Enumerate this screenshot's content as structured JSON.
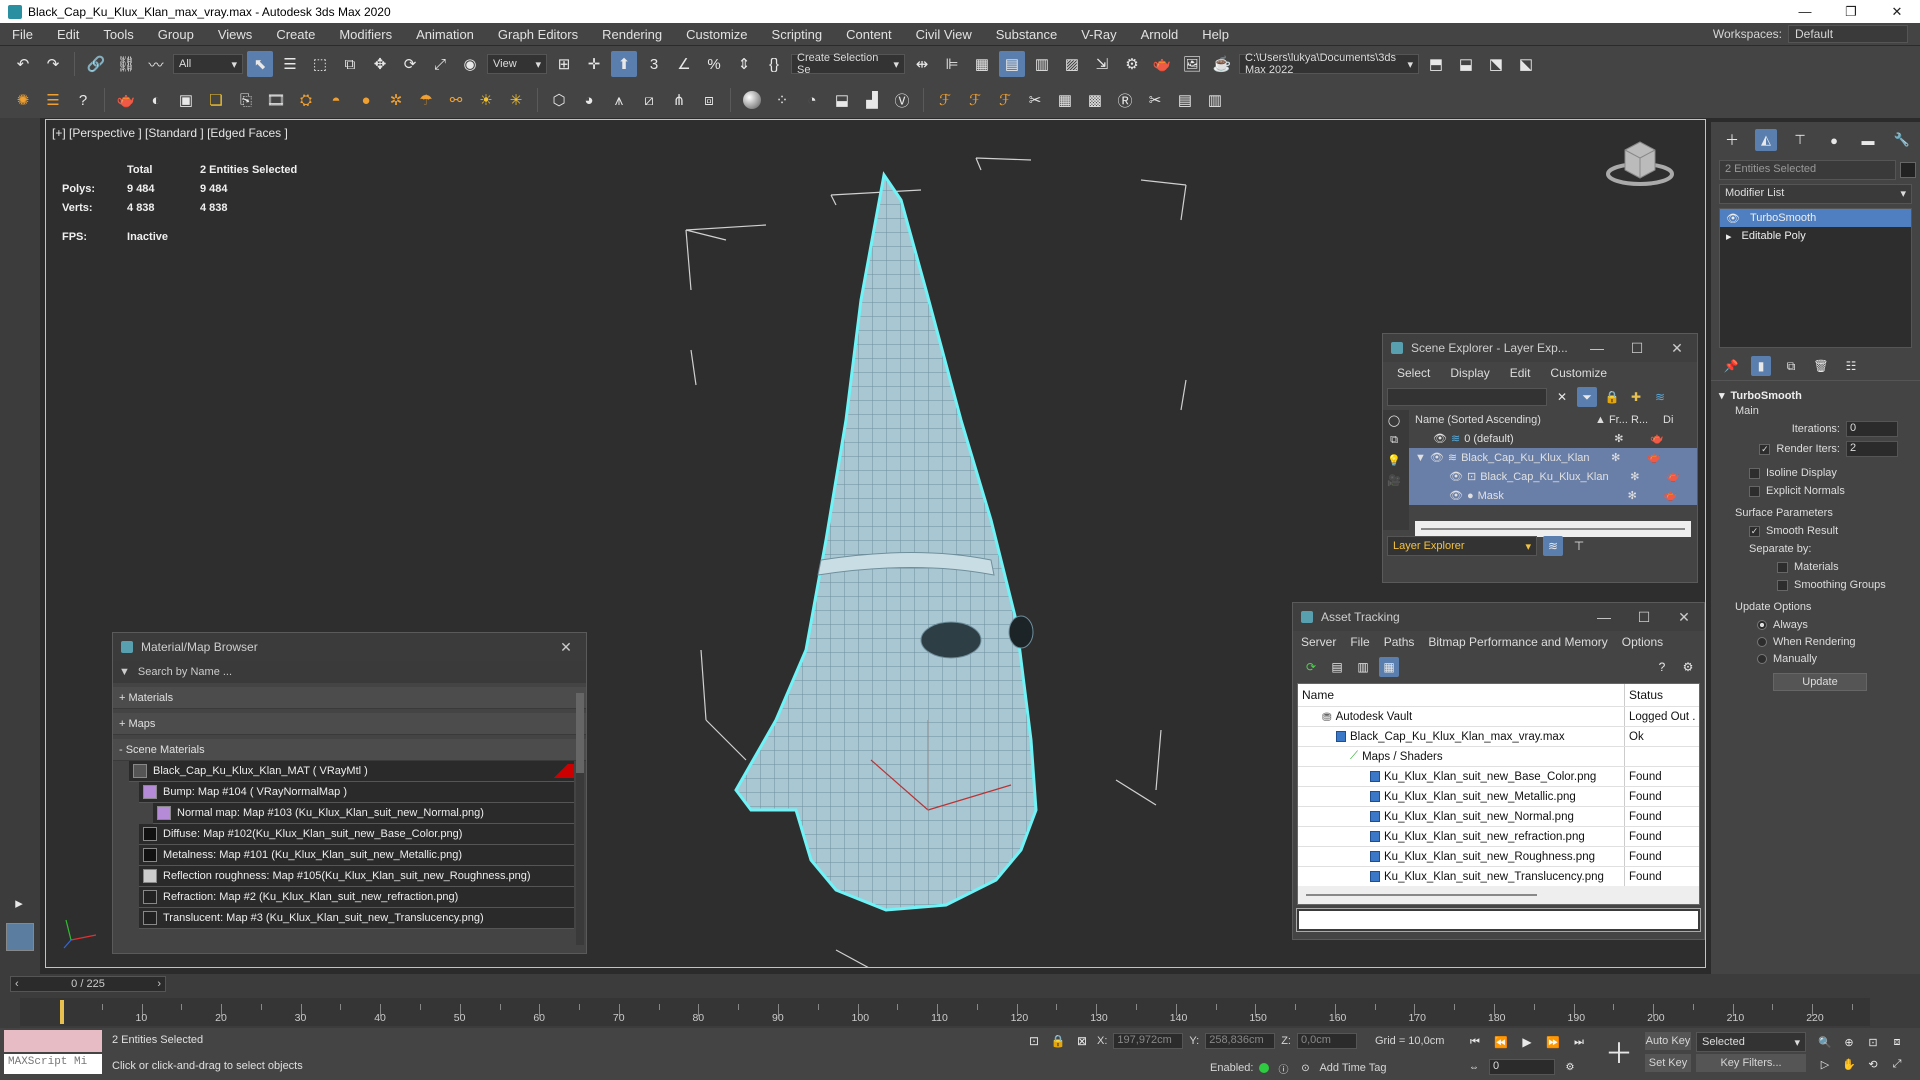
{
  "window": {
    "title": "Black_Cap_Ku_Klux_Klan_max_vray.max - Autodesk 3ds Max 2020"
  },
  "menu": [
    "File",
    "Edit",
    "Tools",
    "Group",
    "Views",
    "Create",
    "Modifiers",
    "Animation",
    "Graph Editors",
    "Rendering",
    "Customize",
    "Scripting",
    "Content",
    "Civil View",
    "Substance",
    "V-Ray",
    "Arnold",
    "Help"
  ],
  "workspace": {
    "label": "Workspaces:",
    "value": "Default"
  },
  "toolbar": {
    "filter": "All",
    "view": "View",
    "selection_set": "Create Selection Se",
    "path": "C:\\Users\\lukya\\Documents\\3ds Max 2022"
  },
  "viewport": {
    "label": "[+] [Perspective ] [Standard ] [Edged Faces ]",
    "stats": {
      "total_label": "Total",
      "selected_label": "2 Entities Selected",
      "polys_label": "Polys:",
      "polys_total": "9 484",
      "polys_sel": "9 484",
      "verts_label": "Verts:",
      "verts_total": "4 838",
      "verts_sel": "4 838",
      "fps_label": "FPS:",
      "fps_value": "Inactive"
    }
  },
  "material_browser": {
    "title": "Material/Map Browser",
    "search_placeholder": "Search by Name ...",
    "sections": [
      "+ Materials",
      "+ Maps",
      "- Scene Materials"
    ],
    "items": [
      {
        "label": "Black_Cap_Ku_Klux_Klan_MAT  ( VRayMtl )",
        "swatch": "#555555"
      },
      {
        "label": "Bump: Map #104  ( VRayNormalMap )",
        "swatch": "#b58bd8"
      },
      {
        "label": "Normal map: Map #103 (Ku_Klux_Klan_suit_new_Normal.png)",
        "swatch": "#b58bd8"
      },
      {
        "label": "Diffuse: Map #102(Ku_Klux_Klan_suit_new_Base_Color.png)",
        "swatch": "#111111"
      },
      {
        "label": "Metalness: Map #101 (Ku_Klux_Klan_suit_new_Metallic.png)",
        "swatch": "#111111"
      },
      {
        "label": "Reflection roughness: Map #105(Ku_Klux_Klan_suit_new_Roughness.png)",
        "swatch": "#cccccc"
      },
      {
        "label": "Refraction: Map #2 (Ku_Klux_Klan_suit_new_refraction.png)",
        "swatch": "#222222"
      },
      {
        "label": "Translucent: Map #3 (Ku_Klux_Klan_suit_new_Translucency.png)",
        "swatch": "#222222"
      }
    ]
  },
  "scene_explorer": {
    "title": "Scene Explorer - Layer Exp...",
    "menu": [
      "Select",
      "Display",
      "Edit",
      "Customize"
    ],
    "col_name": "Name (Sorted Ascending)",
    "col_fr": "▲ Fr...",
    "col_r": "R...",
    "col_di": "Di",
    "rows": [
      {
        "label": "0 (default)",
        "selected": false,
        "indent": 0
      },
      {
        "label": "Black_Cap_Ku_Klux_Klan",
        "selected": true,
        "indent": 0
      },
      {
        "label": "Black_Cap_Ku_Klux_Klan",
        "selected": true,
        "indent": 1
      },
      {
        "label": "Mask",
        "selected": true,
        "indent": 1
      }
    ],
    "footer": "Layer Explorer"
  },
  "asset_tracking": {
    "title": "Asset Tracking",
    "menu": [
      "Server",
      "File",
      "Paths",
      "Bitmap Performance and Memory",
      "Options"
    ],
    "col_name": "Name",
    "col_status": "Status",
    "rows": [
      {
        "name": "Autodesk Vault",
        "status": "Logged Out .",
        "indent": 1
      },
      {
        "name": "Black_Cap_Ku_Klux_Klan_max_vray.max",
        "status": "Ok",
        "indent": 2
      },
      {
        "name": "Maps / Shaders",
        "status": "",
        "indent": 3
      },
      {
        "name": "Ku_Klux_Klan_suit_new_Base_Color.png",
        "status": "Found",
        "indent": 4
      },
      {
        "name": "Ku_Klux_Klan_suit_new_Metallic.png",
        "status": "Found",
        "indent": 4
      },
      {
        "name": "Ku_Klux_Klan_suit_new_Normal.png",
        "status": "Found",
        "indent": 4
      },
      {
        "name": "Ku_Klux_Klan_suit_new_refraction.png",
        "status": "Found",
        "indent": 4
      },
      {
        "name": "Ku_Klux_Klan_suit_new_Roughness.png",
        "status": "Found",
        "indent": 4
      },
      {
        "name": "Ku_Klux_Klan_suit_new_Translucency.png",
        "status": "Found",
        "indent": 4
      }
    ]
  },
  "command_panel": {
    "selection": "2 Entities Selected",
    "modifier_list": "Modifier List",
    "stack": [
      "TurboSmooth",
      "Editable Poly"
    ],
    "rollout_title": "TurboSmooth",
    "main_label": "Main",
    "iterations_label": "Iterations:",
    "iterations_value": "0",
    "render_iters_label": "Render Iters:",
    "render_iters_value": "2",
    "isoline": "Isoline Display",
    "explicit_normals": "Explicit Normals",
    "surface_params": "Surface Parameters",
    "smooth_result": "Smooth Result",
    "separate_by": "Separate by:",
    "sep_materials": "Materials",
    "sep_smoothing": "Smoothing Groups",
    "update_options": "Update Options",
    "opt_always": "Always",
    "opt_when_rendering": "When Rendering",
    "opt_manually": "Manually",
    "update_btn": "Update"
  },
  "timeline": {
    "frame_display": "0 / 225",
    "ticks": [
      "10",
      "20",
      "30",
      "40",
      "50",
      "60",
      "70",
      "80",
      "90",
      "100",
      "110",
      "120",
      "130",
      "140",
      "150",
      "160",
      "170",
      "180",
      "190",
      "200",
      "210",
      "220"
    ]
  },
  "status": {
    "maxscript": "MAXScript Mi",
    "selected": "2 Entities Selected",
    "prompt": "Click or click-and-drag to select objects",
    "x_label": "X:",
    "x_value": "197,972cm",
    "y_label": "Y:",
    "y_value": "258,836cm",
    "z_label": "Z:",
    "z_value": "0,0cm",
    "grid": "Grid = 10,0cm",
    "enabled": "Enabled:",
    "add_time_tag": "Add Time Tag",
    "auto_key": "Auto Key",
    "selected_dd": "Selected",
    "set_key": "Set Key",
    "key_filters": "Key Filters...",
    "frame_value": "0"
  }
}
